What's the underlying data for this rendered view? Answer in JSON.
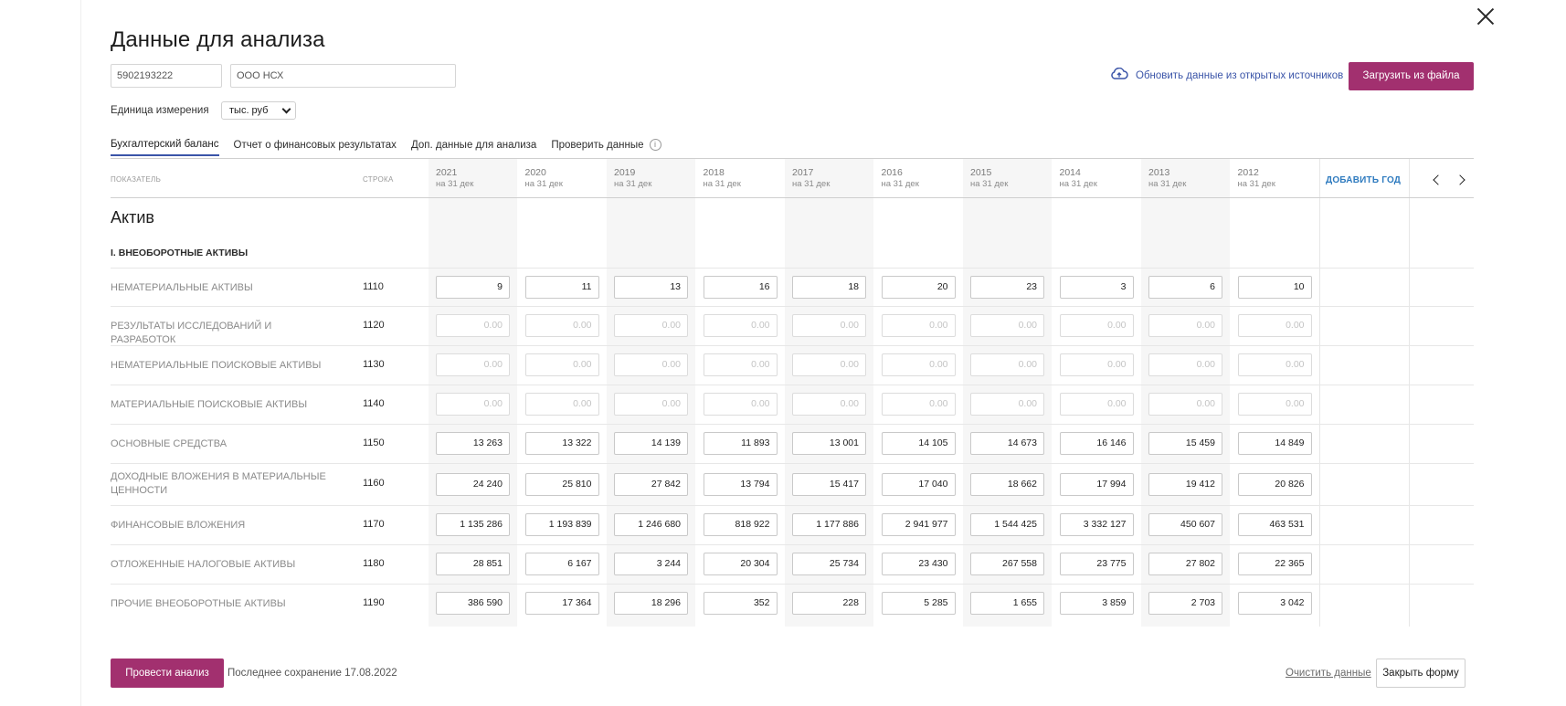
{
  "modal": {
    "title": "Данные для анализа",
    "inn": "5902193222",
    "org_name": "ООО НСХ",
    "unit_label": "Единица измерения",
    "unit_value": "тыс. руб",
    "refresh_label": "Обновить данные из открытых источников",
    "upload_label": "Загрузить из файла",
    "tabs": [
      {
        "label": "Бухгалтерский баланс",
        "active": true
      },
      {
        "label": "Отчет о финансовых результатах",
        "active": false
      },
      {
        "label": "Доп. данные для анализа",
        "active": false
      },
      {
        "label": "Проверить данные",
        "active": false,
        "info_icon": "i"
      }
    ]
  },
  "table": {
    "header_indicator": "ПОКАЗАТЕЛЬ",
    "header_line": "СТРОКА",
    "add_year": "ДОБАВИТЬ ГОД",
    "year_sub": "на 31 дек",
    "years": [
      "2021",
      "2020",
      "2019",
      "2018",
      "2017",
      "2016",
      "2015",
      "2014",
      "2013",
      "2012"
    ],
    "section": "Актив",
    "subsection": "I. ВНЕОБОРОТНЫЕ АКТИВЫ",
    "placeholder": "0.00",
    "rows": [
      {
        "label": "НЕМАТЕРИАЛЬНЫЕ АКТИВЫ",
        "code": "1110",
        "values": [
          "9",
          "11",
          "13",
          "16",
          "18",
          "20",
          "23",
          "3",
          "6",
          "10"
        ]
      },
      {
        "label": "РЕЗУЛЬТАТЫ ИССЛЕДОВАНИЙ И РАЗРАБОТОК",
        "code": "1120",
        "values": [
          "",
          "",
          "",
          "",
          "",
          "",
          "",
          "",
          "",
          ""
        ]
      },
      {
        "label": "НЕМАТЕРИАЛЬНЫЕ ПОИСКОВЫЕ АКТИВЫ",
        "code": "1130",
        "values": [
          "",
          "",
          "",
          "",
          "",
          "",
          "",
          "",
          "",
          ""
        ]
      },
      {
        "label": "МАТЕРИАЛЬНЫЕ ПОИСКОВЫЕ АКТИВЫ",
        "code": "1140",
        "values": [
          "",
          "",
          "",
          "",
          "",
          "",
          "",
          "",
          "",
          ""
        ]
      },
      {
        "label": "ОСНОВНЫЕ СРЕДСТВА",
        "code": "1150",
        "values": [
          "13 263",
          "13 322",
          "14 139",
          "11 893",
          "13 001",
          "14 105",
          "14 673",
          "16 146",
          "15 459",
          "14 849"
        ]
      },
      {
        "label": "ДОХОДНЫЕ ВЛОЖЕНИЯ В МАТЕРИАЛЬНЫЕ ЦЕННОСТИ",
        "code": "1160",
        "values": [
          "24 240",
          "25 810",
          "27 842",
          "13 794",
          "15 417",
          "17 040",
          "18 662",
          "17 994",
          "19 412",
          "20 826"
        ]
      },
      {
        "label": "ФИНАНСОВЫЕ ВЛОЖЕНИЯ",
        "code": "1170",
        "values": [
          "1 135 286",
          "1 193 839",
          "1 246 680",
          "818 922",
          "1 177 886",
          "2 941 977",
          "1 544 425",
          "3 332 127",
          "450 607",
          "463 531"
        ]
      },
      {
        "label": "ОТЛОЖЕННЫЕ НАЛОГОВЫЕ АКТИВЫ",
        "code": "1180",
        "values": [
          "28 851",
          "6 167",
          "3 244",
          "20 304",
          "25 734",
          "23 430",
          "267 558",
          "23 775",
          "27 802",
          "22 365"
        ]
      },
      {
        "label": "ПРОЧИЕ ВНЕОБОРОТНЫЕ АКТИВЫ",
        "code": "1190",
        "values": [
          "386 590",
          "17 364",
          "18 296",
          "352",
          "228",
          "5 285",
          "1 655",
          "3 859",
          "2 703",
          "3 042"
        ]
      }
    ]
  },
  "footer": {
    "analyze_label": "Провести анализ",
    "last_save": "Последнее сохранение 17.08.2022",
    "clear_label": "Очистить данные",
    "close_label": "Закрыть форму"
  },
  "colors": {
    "accent": "#a2306f",
    "link": "#3a54a8",
    "add_year": "#2f7bbf"
  },
  "icons": {
    "close": "close-icon",
    "cloud": "cloud-upload-icon",
    "info": "info-icon",
    "prev": "chevron-left-icon",
    "next": "chevron-right-icon",
    "dropdown": "chevron-down-icon"
  }
}
